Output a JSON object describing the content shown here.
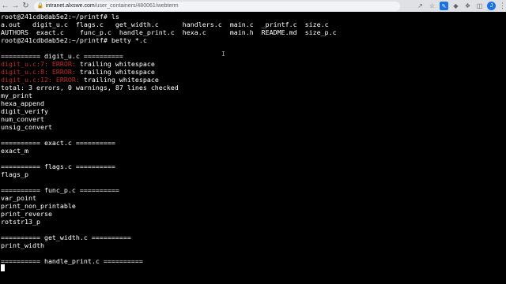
{
  "browser": {
    "url_host": "intranet.alxswe.com",
    "url_path": "/user_containers/480061/webterm",
    "avatar_letter": "J"
  },
  "terminal": {
    "lines": [
      {
        "segments": [
          {
            "text": "root@241cdbdab5e2:~/printf# ls",
            "style": "normal"
          }
        ]
      },
      {
        "segments": [
          {
            "text": "a.out   digit_u.c  flags.c   get_width.c      handlers.c  main.c  _printf.c  size.c",
            "style": "normal"
          }
        ]
      },
      {
        "segments": [
          {
            "text": "AUTHORS  exact.c    func_p.c  handle_print.c  hexa.c      main.h  README.md  size_p.c",
            "style": "normal"
          }
        ]
      },
      {
        "segments": [
          {
            "text": "root@241cdbdab5e2:~/printf# betty *.c",
            "style": "normal"
          }
        ]
      },
      {
        "segments": [
          {
            "text": "",
            "style": "normal"
          }
        ]
      },
      {
        "segments": [
          {
            "text": "========== digit_u.c ==========",
            "style": "normal"
          }
        ]
      },
      {
        "segments": [
          {
            "text": "digit_u.c:7: ERROR:",
            "style": "err"
          },
          {
            "text": " trailing whitespace",
            "style": "normal"
          }
        ]
      },
      {
        "segments": [
          {
            "text": "digit_u.c:8: ERROR:",
            "style": "err"
          },
          {
            "text": " trailing whitespace",
            "style": "normal"
          }
        ]
      },
      {
        "segments": [
          {
            "text": "digit_u.c:12: ERROR:",
            "style": "err"
          },
          {
            "text": " trailing whitespace",
            "style": "normal"
          }
        ]
      },
      {
        "segments": [
          {
            "text": "total: 3 errors, 0 warnings, 87 lines checked",
            "style": "normal"
          }
        ]
      },
      {
        "segments": [
          {
            "text": "my_print",
            "style": "normal"
          }
        ]
      },
      {
        "segments": [
          {
            "text": "hexa_append",
            "style": "normal"
          }
        ]
      },
      {
        "segments": [
          {
            "text": "digit_verify",
            "style": "normal"
          }
        ]
      },
      {
        "segments": [
          {
            "text": "num_convert",
            "style": "normal"
          }
        ]
      },
      {
        "segments": [
          {
            "text": "unsig_convert",
            "style": "normal"
          }
        ]
      },
      {
        "segments": [
          {
            "text": "",
            "style": "normal"
          }
        ]
      },
      {
        "segments": [
          {
            "text": "========== exact.c ==========",
            "style": "normal"
          }
        ]
      },
      {
        "segments": [
          {
            "text": "exact_m",
            "style": "normal"
          }
        ]
      },
      {
        "segments": [
          {
            "text": "",
            "style": "normal"
          }
        ]
      },
      {
        "segments": [
          {
            "text": "========== flags.c ==========",
            "style": "normal"
          }
        ]
      },
      {
        "segments": [
          {
            "text": "flags_p",
            "style": "normal"
          }
        ]
      },
      {
        "segments": [
          {
            "text": "",
            "style": "normal"
          }
        ]
      },
      {
        "segments": [
          {
            "text": "========== func_p.c ==========",
            "style": "normal"
          }
        ]
      },
      {
        "segments": [
          {
            "text": "var_point",
            "style": "normal"
          }
        ]
      },
      {
        "segments": [
          {
            "text": "print_non_printable",
            "style": "normal"
          }
        ]
      },
      {
        "segments": [
          {
            "text": "print_reverse",
            "style": "normal"
          }
        ]
      },
      {
        "segments": [
          {
            "text": "rotstr13_p",
            "style": "normal"
          }
        ]
      },
      {
        "segments": [
          {
            "text": "",
            "style": "normal"
          }
        ]
      },
      {
        "segments": [
          {
            "text": "========== get_width.c ==========",
            "style": "normal"
          }
        ]
      },
      {
        "segments": [
          {
            "text": "print_width",
            "style": "normal"
          }
        ]
      },
      {
        "segments": [
          {
            "text": "",
            "style": "normal"
          }
        ]
      },
      {
        "segments": [
          {
            "text": "========== handle_print.c ==========",
            "style": "normal"
          }
        ]
      }
    ]
  }
}
